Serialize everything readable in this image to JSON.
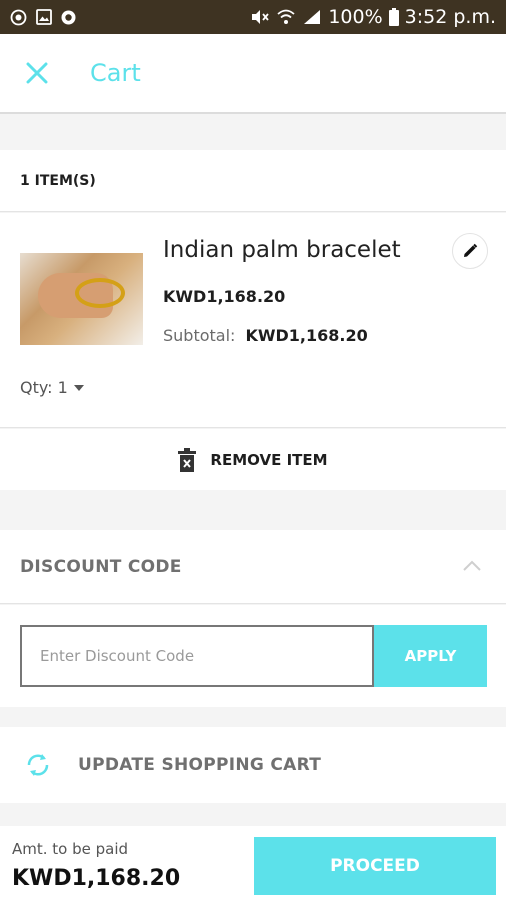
{
  "status_bar": {
    "left_icons": [
      "camera-icon",
      "image-icon",
      "whatsapp-icon"
    ],
    "right_icons": [
      "mute-icon",
      "wifi-icon",
      "signal-icon"
    ],
    "battery": "100%",
    "time": "3:52 p.m."
  },
  "header": {
    "title": "Cart"
  },
  "cart": {
    "items_count": "1 ITEM(S)",
    "product": {
      "name": "Indian palm bracelet",
      "price": "KWD1,168.20",
      "subtotal_label": "Subtotal:",
      "subtotal_value": "KWD1,168.20",
      "qty_label": "Qty: 1"
    },
    "remove_label": "REMOVE ITEM"
  },
  "discount": {
    "title": "DISCOUNT CODE",
    "placeholder": "Enter Discount Code",
    "apply_label": "APPLY"
  },
  "update_label": "UPDATE SHOPPING CART",
  "footer": {
    "amount_label": "Amt. to be paid",
    "amount_value": "KWD1,168.20",
    "proceed_label": "PROCEED"
  },
  "colors": {
    "accent": "#5ce1ea",
    "statusbar": "#3e3322"
  }
}
